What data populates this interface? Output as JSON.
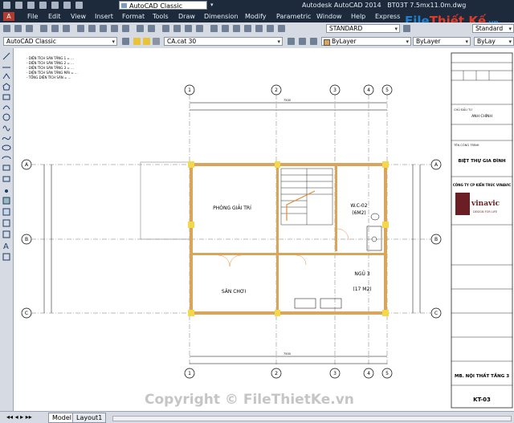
{
  "titlebar": {
    "workspace": "AutoCAD Classic",
    "app_title": "Autodesk AutoCAD 2014",
    "file_name": "BT03T 7.5mx11.0m.dwg"
  },
  "menu": [
    "File",
    "Edit",
    "View",
    "Insert",
    "Format",
    "Tools",
    "Draw",
    "Dimension",
    "Modify",
    "Parametric",
    "Window",
    "Help",
    "Express"
  ],
  "toolbar2": {
    "workspace": "AutoCAD Classic",
    "layer": "CA.cat 30",
    "text_style": "STANDARD",
    "color": "ByLayer",
    "linetype": "ByLayer",
    "dim_style": "Standard",
    "right_label": "ByLay"
  },
  "logo": {
    "part1": "File",
    "part2": "Thiết Kế",
    "part3": ".vn"
  },
  "drawing": {
    "notes": [
      "- DIỆN TÍCH SÀN TẦNG 1 = ...",
      "- DIỆN TÍCH SÀN TẦNG 2 = ...",
      "- DIỆN TÍCH SÀN TẦNG 3 = ...",
      "- DIỆN TÍCH SÀN TẦNG MÁI = ...",
      "- TỔNG DIỆN TÍCH SÀN = ..."
    ],
    "rooms": {
      "entertainment": "PHÒNG GIẢI TRÍ",
      "wc": "W.C-02",
      "wc_area": "(6M2)",
      "playground": "SÂN CHƠI",
      "bedroom": "NGỦ 3",
      "bedroom_area": "(17 M2)"
    },
    "grid_numbers": [
      "1",
      "2",
      "3",
      "4",
      "5"
    ],
    "grid_letters": [
      "A",
      "B",
      "C"
    ],
    "total_dim": "7500"
  },
  "title_block": {
    "owner_label": "CHỦ ĐẦU TƯ",
    "owner": "ANH CHÍNH",
    "project_label": "TÊN CÔNG TRÌNH",
    "project": "BIỆT THỰ GIA ĐÌNH",
    "company": "CÔNG TY CP KIẾN TRÚC VINAVIC",
    "company_logo": "vinavic",
    "company_tagline": "DESIGN FOR LIFE",
    "drawing_title": "MB. NỘI THẤT TẦNG 3",
    "drawing_number": "KT-03"
  },
  "status": {
    "tabs": [
      "Model",
      "Layout1"
    ]
  },
  "watermark": "Copyright © FileThietKe.vn",
  "colors": {
    "title_bg": "#1c2a3c",
    "toolbar_bg": "#d6dbe3",
    "canvas_bg": "#ffffff",
    "wall_fill": "#d9a55a",
    "column_fill": "#f2d84a",
    "stair_accent": "#e08a3a"
  }
}
